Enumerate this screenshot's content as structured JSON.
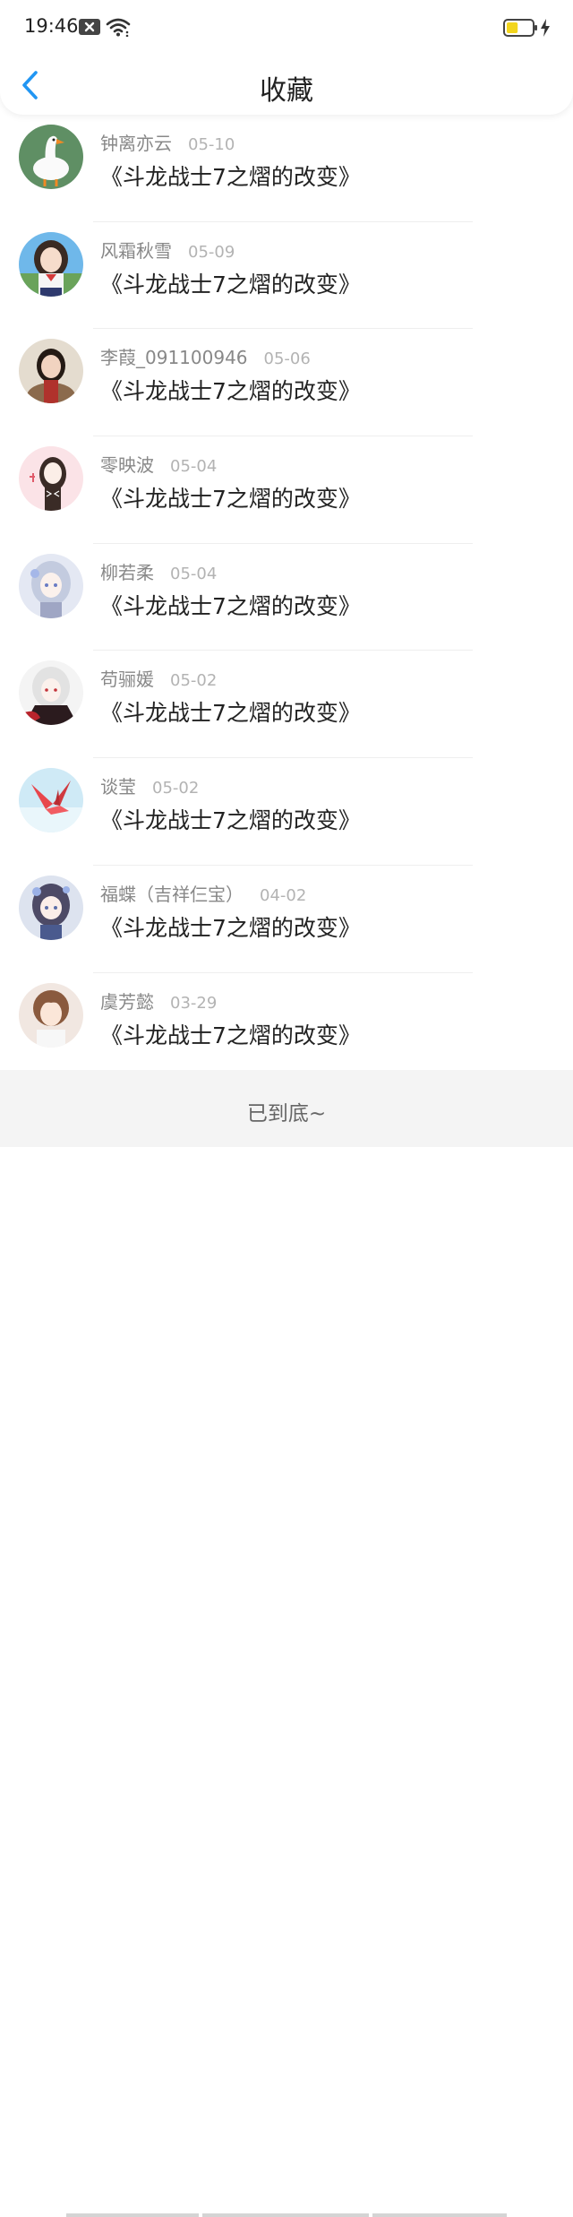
{
  "status_bar": {
    "time": "19:46",
    "icons": [
      "notification-icon",
      "wifi-icon",
      "battery-icon",
      "charging-icon"
    ],
    "battery_level": 0.45,
    "battery_color": "#f2d51d"
  },
  "nav": {
    "title": "收藏",
    "back_icon": "chevron-left-icon",
    "accent_color": "#2196f3"
  },
  "items": [
    {
      "name": "钟离亦云",
      "date": "05-10",
      "title": "《斗龙战士7之熠的改变》",
      "avatar": "goose-avatar"
    },
    {
      "name": "风霜秋雪",
      "date": "05-09",
      "title": "《斗龙战士7之熠的改变》",
      "avatar": "anime-girl-avatar"
    },
    {
      "name": "李葭_091100946",
      "date": "05-06",
      "title": "《斗龙战士7之熠的改变》",
      "avatar": "photo-avatar"
    },
    {
      "name": "零映波",
      "date": "05-04",
      "title": "《斗龙战士7之熠的改变》",
      "avatar": "illustrated-girl-avatar"
    },
    {
      "name": "柳若柔",
      "date": "05-04",
      "title": "《斗龙战士7之熠的改变》",
      "avatar": "silver-hair-avatar"
    },
    {
      "name": "苟骊媛",
      "date": "05-02",
      "title": "《斗龙战士7之熠的改变》",
      "avatar": "white-hair-avatar"
    },
    {
      "name": "谈莹",
      "date": "05-02",
      "title": "《斗龙战士7之熠的改变》",
      "avatar": "paper-crane-avatar"
    },
    {
      "name": "福蝶（吉祥仨宝）",
      "date": "04-02",
      "title": "《斗龙战士7之熠的改变》",
      "avatar": "anime-flower-avatar"
    },
    {
      "name": "虞芳懿",
      "date": "03-29",
      "title": "《斗龙战士7之熠的改变》",
      "avatar": "anime-boy-avatar"
    }
  ],
  "footer": {
    "end_text": "已到底~"
  }
}
